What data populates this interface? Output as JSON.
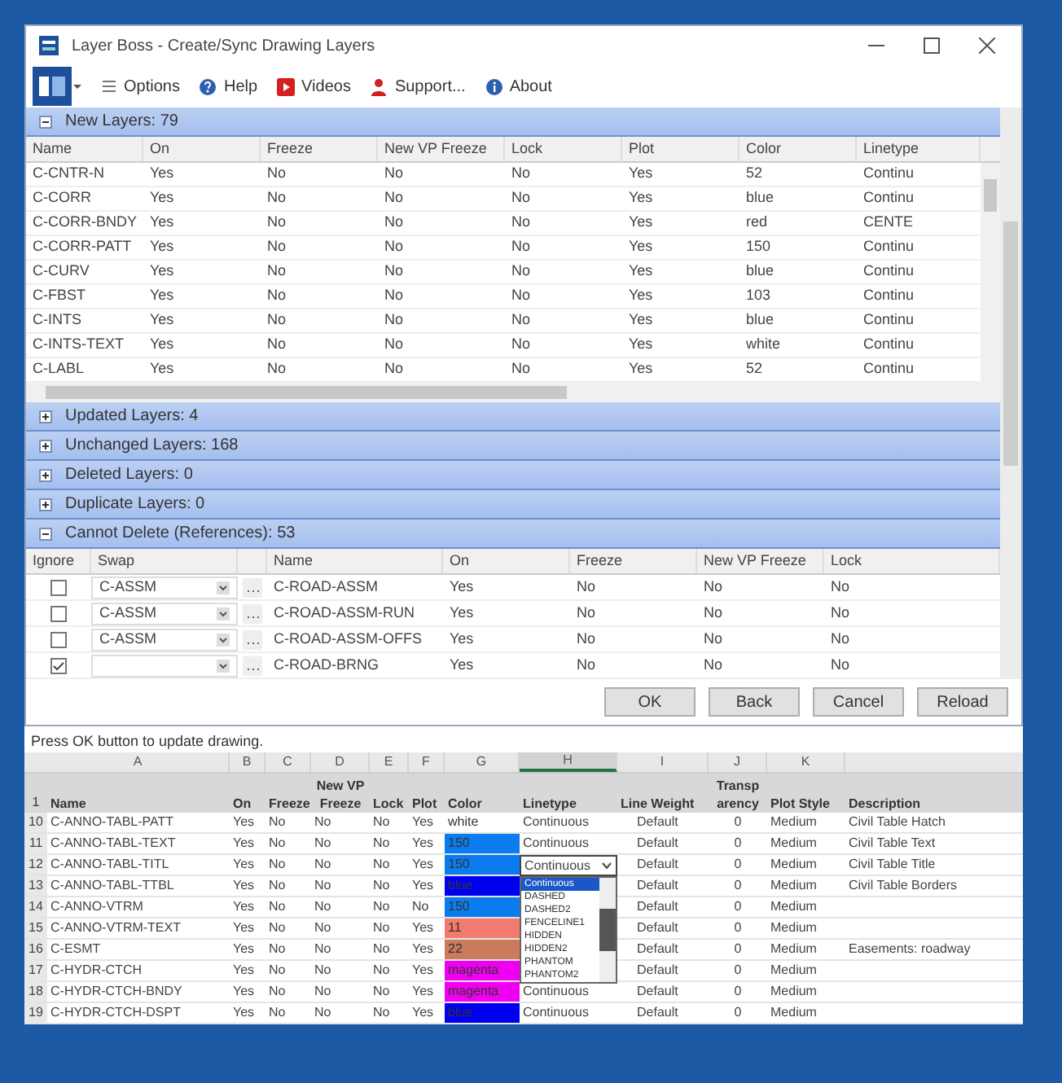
{
  "window": {
    "title": "Layer Boss - Create/Sync Drawing Layers"
  },
  "toolbar": [
    {
      "kind": "options",
      "label": "Options"
    },
    {
      "kind": "help",
      "label": "Help"
    },
    {
      "kind": "videos",
      "label": "Videos"
    },
    {
      "kind": "support",
      "label": "Support..."
    },
    {
      "kind": "about",
      "label": "About"
    }
  ],
  "new_layers": {
    "title": "New Layers: 79",
    "expanded": true,
    "columns": [
      "Name",
      "On",
      "Freeze",
      "New VP Freeze",
      "Lock",
      "Plot",
      "Color",
      "Linetype"
    ],
    "rows": [
      [
        "C-CNTR-N",
        "Yes",
        "No",
        "No",
        "No",
        "Yes",
        "52",
        "Continu"
      ],
      [
        "C-CORR",
        "Yes",
        "No",
        "No",
        "No",
        "Yes",
        "blue",
        "Continu"
      ],
      [
        "C-CORR-BNDY",
        "Yes",
        "No",
        "No",
        "No",
        "Yes",
        "red",
        "CENTE"
      ],
      [
        "C-CORR-PATT",
        "Yes",
        "No",
        "No",
        "No",
        "Yes",
        "150",
        "Continu"
      ],
      [
        "C-CURV",
        "Yes",
        "No",
        "No",
        "No",
        "Yes",
        "blue",
        "Continu"
      ],
      [
        "C-FBST",
        "Yes",
        "No",
        "No",
        "No",
        "Yes",
        "103",
        "Continu"
      ],
      [
        "C-INTS",
        "Yes",
        "No",
        "No",
        "No",
        "Yes",
        "blue",
        "Continu"
      ],
      [
        "C-INTS-TEXT",
        "Yes",
        "No",
        "No",
        "No",
        "Yes",
        "white",
        "Continu"
      ],
      [
        "C-LABL",
        "Yes",
        "No",
        "No",
        "No",
        "Yes",
        "52",
        "Continu"
      ]
    ]
  },
  "sections": [
    {
      "title": "Updated Layers: 4",
      "expanded": false
    },
    {
      "title": "Unchanged Layers: 168",
      "expanded": false
    },
    {
      "title": "Deleted Layers: 0",
      "expanded": false
    },
    {
      "title": "Duplicate Layers: 0",
      "expanded": false
    },
    {
      "title": "Cannot Delete (References): 53",
      "expanded": true
    }
  ],
  "cannot_delete": {
    "columns": [
      "Ignore",
      "Swap",
      "",
      "Name",
      "On",
      "Freeze",
      "New VP Freeze",
      "Lock"
    ],
    "rows": [
      [
        {
          "kind": "checkbox",
          "checked": false
        },
        {
          "kind": "combo",
          "text": "C-ASSM"
        },
        {
          "kind": "more"
        },
        {
          "kind": "text",
          "text": "C-ROAD-ASSM"
        },
        {
          "kind": "text",
          "text": "Yes"
        },
        {
          "kind": "text",
          "text": "No"
        },
        {
          "kind": "text",
          "text": "No"
        },
        {
          "kind": "text",
          "text": "No"
        }
      ],
      [
        {
          "kind": "checkbox",
          "checked": false
        },
        {
          "kind": "combo",
          "text": "C-ASSM"
        },
        {
          "kind": "more"
        },
        {
          "kind": "text",
          "text": "C-ROAD-ASSM-RUN"
        },
        {
          "kind": "text",
          "text": "Yes"
        },
        {
          "kind": "text",
          "text": "No"
        },
        {
          "kind": "text",
          "text": "No"
        },
        {
          "kind": "text",
          "text": "No"
        }
      ],
      [
        {
          "kind": "checkbox",
          "checked": false
        },
        {
          "kind": "combo",
          "text": "C-ASSM"
        },
        {
          "kind": "more"
        },
        {
          "kind": "text",
          "text": "C-ROAD-ASSM-OFFS"
        },
        {
          "kind": "text",
          "text": "Yes"
        },
        {
          "kind": "text",
          "text": "No"
        },
        {
          "kind": "text",
          "text": "No"
        },
        {
          "kind": "text",
          "text": "No"
        }
      ],
      [
        {
          "kind": "checkbox",
          "checked": true
        },
        {
          "kind": "combo"
        },
        {
          "kind": "more"
        },
        {
          "kind": "text",
          "text": "C-ROAD-BRNG"
        },
        {
          "kind": "text",
          "text": "Yes"
        },
        {
          "kind": "text",
          "text": "No"
        },
        {
          "kind": "text",
          "text": "No"
        },
        {
          "kind": "text",
          "text": "No"
        }
      ]
    ]
  },
  "buttons": [
    "OK",
    "Back",
    "Cancel",
    "Reload"
  ],
  "status": "Press OK button to update drawing.",
  "sheet": {
    "letters": [
      {
        "label": "A",
        "selected": false
      },
      {
        "label": "B",
        "selected": false
      },
      {
        "label": "C",
        "selected": false
      },
      {
        "label": "D",
        "selected": false
      },
      {
        "label": "E",
        "selected": false
      },
      {
        "label": "F",
        "selected": false
      },
      {
        "label": "G",
        "selected": false
      },
      {
        "label": "H",
        "selected": true
      },
      {
        "label": "I",
        "selected": false
      },
      {
        "label": "J",
        "selected": false
      },
      {
        "label": "K",
        "selected": false
      }
    ],
    "header_number": "1",
    "headers": [
      {
        "label": "Name"
      },
      {
        "label": "On"
      },
      {
        "label": "Freeze"
      },
      {
        "top": "New VP",
        "label": "Freeze"
      },
      {
        "label": "Lock"
      },
      {
        "label": "Plot"
      },
      {
        "label": "Color"
      },
      {
        "label": "Linetype"
      },
      {
        "label": "Line Weight"
      },
      {
        "top": "Transp",
        "label": "arency"
      },
      {
        "label": "Plot Style"
      },
      {
        "label": "Description"
      }
    ],
    "rows": [
      {
        "number": "10",
        "name": "C-ANNO-TABL-PATT",
        "on": "Yes",
        "freeze": "No",
        "vp": "No",
        "lock": "No",
        "plot": "Yes",
        "color_text": "white",
        "color": "#ffffff",
        "linetype": "Continuous",
        "weight": "Default",
        "transp": "0",
        "style": "Medium",
        "description": "Civil Table Hatch"
      },
      {
        "number": "11",
        "name": "C-ANNO-TABL-TEXT",
        "on": "Yes",
        "freeze": "No",
        "vp": "No",
        "lock": "No",
        "plot": "Yes",
        "color_text": "150",
        "color": "#0a7cf0",
        "linetype": "Continuous",
        "weight": "Default",
        "transp": "0",
        "style": "Medium",
        "description": "Civil Table Text"
      },
      {
        "number": "12",
        "name": "C-ANNO-TABL-TITL",
        "on": "Yes",
        "freeze": "No",
        "vp": "No",
        "lock": "No",
        "plot": "Yes",
        "color_text": "150",
        "color": "#0a7cf0",
        "weight": "Default",
        "transp": "0",
        "style": "Medium",
        "description": "Civil Table Title",
        "editor": {
          "value": "Continuous",
          "options": [
            {
              "label": "Continuous",
              "selected": true
            },
            {
              "label": "DASHED",
              "selected": false
            },
            {
              "label": "DASHED2",
              "selected": false
            },
            {
              "label": "FENCELINE1",
              "selected": false
            },
            {
              "label": "HIDDEN",
              "selected": false
            },
            {
              "label": "HIDDEN2",
              "selected": false
            },
            {
              "label": "PHANTOM",
              "selected": false
            },
            {
              "label": "PHANTOM2",
              "selected": false
            }
          ]
        }
      },
      {
        "number": "13",
        "name": "C-ANNO-TABL-TTBL",
        "on": "Yes",
        "freeze": "No",
        "vp": "No",
        "lock": "No",
        "plot": "Yes",
        "color_text": "blue",
        "color": "#0000f0",
        "weight": "Default",
        "transp": "0",
        "style": "Medium",
        "description": "Civil Table Borders"
      },
      {
        "number": "14",
        "name": "C-ANNO-VTRM",
        "on": "Yes",
        "freeze": "No",
        "vp": "No",
        "lock": "No",
        "plot": "No",
        "color_text": "150",
        "color": "#0a7cf0",
        "weight": "Default",
        "transp": "0",
        "style": "Medium"
      },
      {
        "number": "15",
        "name": "C-ANNO-VTRM-TEXT",
        "on": "Yes",
        "freeze": "No",
        "vp": "No",
        "lock": "No",
        "plot": "Yes",
        "color_text": "11",
        "color": "#f27a6e",
        "weight": "Default",
        "transp": "0",
        "style": "Medium"
      },
      {
        "number": "16",
        "name": "C-ESMT",
        "on": "Yes",
        "freeze": "No",
        "vp": "No",
        "lock": "No",
        "plot": "Yes",
        "color_text": "22",
        "color": "#cc7a5c",
        "weight": "Default",
        "transp": "0",
        "style": "Medium",
        "description": "Easements: roadway"
      },
      {
        "number": "17",
        "name": "C-HYDR-CTCH",
        "on": "Yes",
        "freeze": "No",
        "vp": "No",
        "lock": "No",
        "plot": "Yes",
        "color_text": "magenta",
        "color": "#f000f0",
        "weight": "Default",
        "transp": "0",
        "style": "Medium"
      },
      {
        "number": "18",
        "name": "C-HYDR-CTCH-BNDY",
        "on": "Yes",
        "freeze": "No",
        "vp": "No",
        "lock": "No",
        "plot": "Yes",
        "color_text": "magenta",
        "color": "#f000f0",
        "linetype": "Continuous",
        "weight": "Default",
        "transp": "0",
        "style": "Medium"
      },
      {
        "number": "19",
        "name": "C-HYDR-CTCH-DSPT",
        "on": "Yes",
        "freeze": "No",
        "vp": "No",
        "lock": "No",
        "plot": "Yes",
        "color_text": "blue",
        "color": "#0000f0",
        "linetype": "Continuous",
        "weight": "Default",
        "transp": "0",
        "style": "Medium"
      }
    ]
  }
}
